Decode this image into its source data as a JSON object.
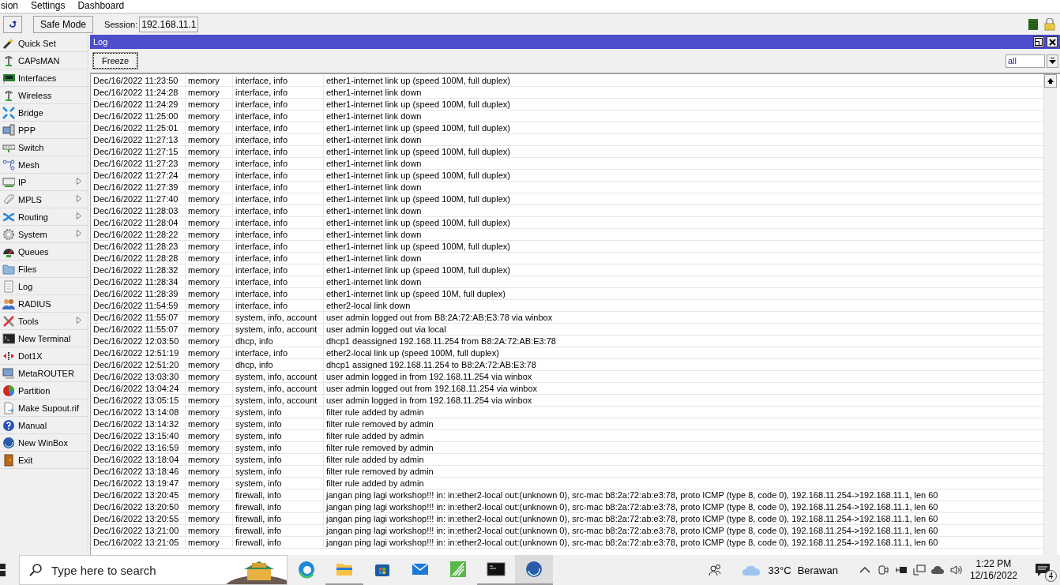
{
  "menu_bar": [
    "sion",
    "Settings",
    "Dashboard"
  ],
  "toolbar": {
    "safe_mode": {
      "label": "Safe Mode",
      "on": false
    },
    "session_label": "Session:",
    "session_value": "192.168.11.1"
  },
  "sidebar": {
    "items": [
      {
        "label": "Quick Set",
        "submenu": false
      },
      {
        "label": "CAPsMAN",
        "submenu": false
      },
      {
        "label": "Interfaces",
        "submenu": false
      },
      {
        "label": "Wireless",
        "submenu": false
      },
      {
        "label": "Bridge",
        "submenu": false
      },
      {
        "label": "PPP",
        "submenu": false
      },
      {
        "label": "Switch",
        "submenu": false
      },
      {
        "label": "Mesh",
        "submenu": false
      },
      {
        "label": "IP",
        "submenu": true
      },
      {
        "label": "MPLS",
        "submenu": true
      },
      {
        "label": "Routing",
        "submenu": true
      },
      {
        "label": "System",
        "submenu": true
      },
      {
        "label": "Queues",
        "submenu": false
      },
      {
        "label": "Files",
        "submenu": false
      },
      {
        "label": "Log",
        "submenu": false
      },
      {
        "label": "RADIUS",
        "submenu": false
      },
      {
        "label": "Tools",
        "submenu": true
      },
      {
        "label": "New Terminal",
        "submenu": false
      },
      {
        "label": "Dot1X",
        "submenu": false
      },
      {
        "label": "MetaROUTER",
        "submenu": false
      },
      {
        "label": "Partition",
        "submenu": false
      },
      {
        "label": "Make Supout.rif",
        "submenu": false
      },
      {
        "label": "Manual",
        "submenu": false
      },
      {
        "label": "New WinBox",
        "submenu": false
      },
      {
        "label": "Exit",
        "submenu": false
      }
    ]
  },
  "log_window": {
    "title": "Log",
    "freeze_button": "Freeze",
    "filter_value": "all",
    "rows": [
      [
        "Dec/16/2022 11:23:50",
        "memory",
        "interface, info",
        "ether1-internet link up (speed 100M, full duplex)"
      ],
      [
        "Dec/16/2022 11:24:28",
        "memory",
        "interface, info",
        "ether1-internet link down"
      ],
      [
        "Dec/16/2022 11:24:29",
        "memory",
        "interface, info",
        "ether1-internet link up (speed 100M, full duplex)"
      ],
      [
        "Dec/16/2022 11:25:00",
        "memory",
        "interface, info",
        "ether1-internet link down"
      ],
      [
        "Dec/16/2022 11:25:01",
        "memory",
        "interface, info",
        "ether1-internet link up (speed 100M, full duplex)"
      ],
      [
        "Dec/16/2022 11:27:13",
        "memory",
        "interface, info",
        "ether1-internet link down"
      ],
      [
        "Dec/16/2022 11:27:15",
        "memory",
        "interface, info",
        "ether1-internet link up (speed 100M, full duplex)"
      ],
      [
        "Dec/16/2022 11:27:23",
        "memory",
        "interface, info",
        "ether1-internet link down"
      ],
      [
        "Dec/16/2022 11:27:24",
        "memory",
        "interface, info",
        "ether1-internet link up (speed 100M, full duplex)"
      ],
      [
        "Dec/16/2022 11:27:39",
        "memory",
        "interface, info",
        "ether1-internet link down"
      ],
      [
        "Dec/16/2022 11:27:40",
        "memory",
        "interface, info",
        "ether1-internet link up (speed 100M, full duplex)"
      ],
      [
        "Dec/16/2022 11:28:03",
        "memory",
        "interface, info",
        "ether1-internet link down"
      ],
      [
        "Dec/16/2022 11:28:04",
        "memory",
        "interface, info",
        "ether1-internet link up (speed 100M, full duplex)"
      ],
      [
        "Dec/16/2022 11:28:22",
        "memory",
        "interface, info",
        "ether1-internet link down"
      ],
      [
        "Dec/16/2022 11:28:23",
        "memory",
        "interface, info",
        "ether1-internet link up (speed 100M, full duplex)"
      ],
      [
        "Dec/16/2022 11:28:28",
        "memory",
        "interface, info",
        "ether1-internet link down"
      ],
      [
        "Dec/16/2022 11:28:32",
        "memory",
        "interface, info",
        "ether1-internet link up (speed 100M, full duplex)"
      ],
      [
        "Dec/16/2022 11:28:34",
        "memory",
        "interface, info",
        "ether1-internet link down"
      ],
      [
        "Dec/16/2022 11:28:39",
        "memory",
        "interface, info",
        "ether1-internet link up (speed 10M, full duplex)"
      ],
      [
        "Dec/16/2022 11:54:59",
        "memory",
        "interface, info",
        "ether2-local link down"
      ],
      [
        "Dec/16/2022 11:55:07",
        "memory",
        "system, info, account",
        "user admin logged out from B8:2A:72:AB:E3:78 via winbox"
      ],
      [
        "Dec/16/2022 11:55:07",
        "memory",
        "system, info, account",
        "user admin logged out via local"
      ],
      [
        "Dec/16/2022 12:03:50",
        "memory",
        "dhcp, info",
        "dhcp1 deassigned 192.168.11.254 from B8:2A:72:AB:E3:78"
      ],
      [
        "Dec/16/2022 12:51:19",
        "memory",
        "interface, info",
        "ether2-local link up (speed 100M, full duplex)"
      ],
      [
        "Dec/16/2022 12:51:20",
        "memory",
        "dhcp, info",
        "dhcp1 assigned 192.168.11.254 to B8:2A:72:AB:E3:78"
      ],
      [
        "Dec/16/2022 13:03:30",
        "memory",
        "system, info, account",
        "user admin logged in from 192.168.11.254 via winbox"
      ],
      [
        "Dec/16/2022 13:04:24",
        "memory",
        "system, info, account",
        "user admin logged out from 192.168.11.254 via winbox"
      ],
      [
        "Dec/16/2022 13:05:15",
        "memory",
        "system, info, account",
        "user admin logged in from 192.168.11.254 via winbox"
      ],
      [
        "Dec/16/2022 13:14:08",
        "memory",
        "system, info",
        "filter rule added by admin"
      ],
      [
        "Dec/16/2022 13:14:32",
        "memory",
        "system, info",
        "filter rule removed by admin"
      ],
      [
        "Dec/16/2022 13:15:40",
        "memory",
        "system, info",
        "filter rule added by admin"
      ],
      [
        "Dec/16/2022 13:16:59",
        "memory",
        "system, info",
        "filter rule removed by admin"
      ],
      [
        "Dec/16/2022 13:18:04",
        "memory",
        "system, info",
        "filter rule added by admin"
      ],
      [
        "Dec/16/2022 13:18:46",
        "memory",
        "system, info",
        "filter rule removed by admin"
      ],
      [
        "Dec/16/2022 13:19:47",
        "memory",
        "system, info",
        "filter rule added by admin"
      ],
      [
        "Dec/16/2022 13:20:45",
        "memory",
        "firewall, info",
        "jangan ping lagi workshop!!! in: in:ether2-local out:(unknown 0), src-mac b8:2a:72:ab:e3:78, proto ICMP (type 8, code 0), 192.168.11.254->192.168.11.1, len 60"
      ],
      [
        "Dec/16/2022 13:20:50",
        "memory",
        "firewall, info",
        "jangan ping lagi workshop!!! in: in:ether2-local out:(unknown 0), src-mac b8:2a:72:ab:e3:78, proto ICMP (type 8, code 0), 192.168.11.254->192.168.11.1, len 60"
      ],
      [
        "Dec/16/2022 13:20:55",
        "memory",
        "firewall, info",
        "jangan ping lagi workshop!!! in: in:ether2-local out:(unknown 0), src-mac b8:2a:72:ab:e3:78, proto ICMP (type 8, code 0), 192.168.11.254->192.168.11.1, len 60"
      ],
      [
        "Dec/16/2022 13:21:00",
        "memory",
        "firewall, info",
        "jangan ping lagi workshop!!! in: in:ether2-local out:(unknown 0), src-mac b8:2a:72:ab:e3:78, proto ICMP (type 8, code 0), 192.168.11.254->192.168.11.1, len 60"
      ],
      [
        "Dec/16/2022 13:21:05",
        "memory",
        "firewall, info",
        "jangan ping lagi workshop!!! in: in:ether2-local out:(unknown 0), src-mac b8:2a:72:ab:e3:78, proto ICMP (type 8, code 0), 192.168.11.254->192.168.11.1, len 60"
      ]
    ]
  },
  "taskbar": {
    "search_placeholder": "Type here to search",
    "temperature": "33°C",
    "weather": "Berawan",
    "time": "1:22 PM",
    "date": "12/16/2022",
    "notifications": "4"
  }
}
